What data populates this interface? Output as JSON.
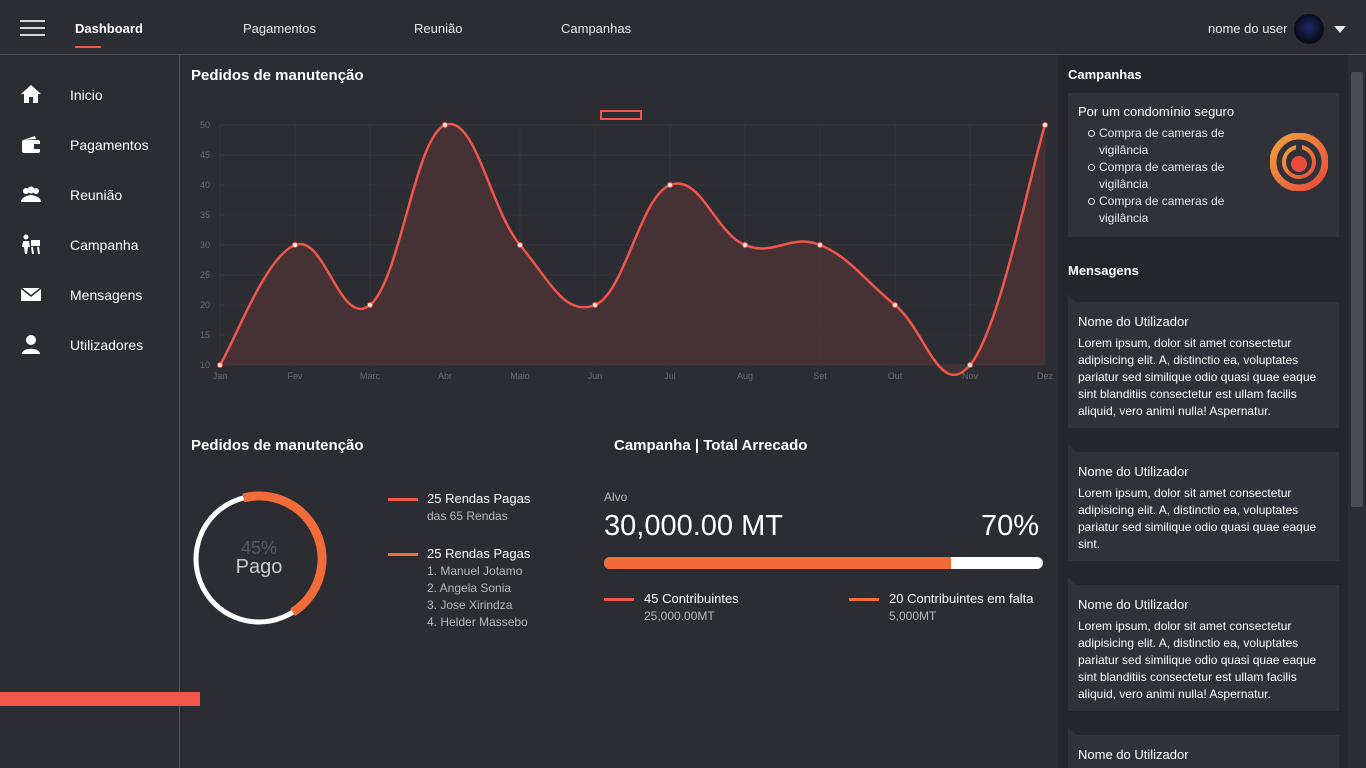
{
  "topbar": {
    "nav": [
      "Dashboard",
      "Pagamentos",
      "Reunião",
      "Campanhas"
    ],
    "user_name": "nome do user",
    "icons": {
      "menu": "hamburger-icon",
      "caret": "caret-down-icon"
    }
  },
  "sidebar": {
    "items": [
      {
        "label": "Inicio",
        "icon": "home-icon"
      },
      {
        "label": "Pagamentos",
        "icon": "wallet-icon"
      },
      {
        "label": "Reunião",
        "icon": "group-icon"
      },
      {
        "label": "Campanha",
        "icon": "campaign-icon"
      },
      {
        "label": "Mensagens",
        "icon": "envelope-icon"
      },
      {
        "label": "Utilizadores",
        "icon": "user-icon"
      }
    ]
  },
  "main": {
    "chart_title": "Pedidos de manutenção",
    "donut_title": "Pedidos de manutenção",
    "donut": {
      "percent_label": "45%",
      "label": "Pago",
      "value": 45
    },
    "legend": [
      {
        "title": "25 Rendas Pagas",
        "sub": [
          "das 65 Rendas"
        ]
      },
      {
        "title": "25 Rendas Pagas",
        "sub": [
          "1. Manuel Jotamo",
          "2. Angela Sonia",
          "3. Jose Xirindza",
          "4. Helder Massebo"
        ]
      }
    ],
    "campaign_title": "Campanha | Total Arrecado",
    "target_label": "Alvo",
    "target_amount": "30,000.00 MT",
    "target_percent_label": "70%",
    "target_percent_value": 79,
    "contrib": [
      {
        "title": "45 Contribuintes",
        "sub": "25,000.00MT"
      },
      {
        "title": "20 Contribuintes em falta",
        "sub": "5,000MT"
      }
    ]
  },
  "chart_data": {
    "type": "area",
    "categories": [
      "Jan",
      "Fev",
      "Marc",
      "Abr",
      "Maio",
      "Jun",
      "Jul",
      "Aug",
      "Set",
      "Out",
      "Nov",
      "Dez"
    ],
    "series": [
      {
        "values": [
          10,
          30,
          20,
          50,
          30,
          20,
          40,
          30,
          30,
          20,
          10,
          50
        ]
      }
    ],
    "ylim": [
      10,
      50
    ],
    "yticks": [
      10,
      15,
      20,
      25,
      30,
      35,
      40,
      45,
      50
    ],
    "grid": true,
    "legend": "top-center",
    "color": "#f0564a",
    "fill_color": "#4b3236"
  },
  "right": {
    "campanhas_title": "Campanhas",
    "campaign": {
      "title": "Por um condomínio seguro",
      "items": [
        "Compra de cameras de vigilância",
        "Compra de cameras de vigilância",
        "Compra de cameras de vigilância"
      ],
      "logo": "campaign-logo-icon"
    },
    "mensagens_title": "Mensagens",
    "messages": [
      {
        "name": "Nome do Utilizador",
        "text": "Lorem ipsum, dolor sit amet consectetur adipisicing elit. A, distinctio ea, voluptates pariatur sed similique odio quasi quae eaque sint blanditiis consectetur est ullam facilis aliquid, vero animi nulla! Aspernatur."
      },
      {
        "name": "Nome do Utilizador",
        "text": "Lorem ipsum, dolor sit amet consectetur adipisicing elit. A, distinctio ea, voluptates pariatur sed similique odio quasi quae eaque sint."
      },
      {
        "name": "Nome do Utilizador",
        "text": "Lorem ipsum, dolor sit amet consectetur adipisicing elit. A, distinctio ea, voluptates pariatur sed similique odio quasi quae eaque sint blanditiis consectetur est ullam facilis aliquid, vero animi nulla! Aspernatur."
      },
      {
        "name": "Nome do Utilizador",
        "text": ""
      }
    ]
  },
  "colors": {
    "background": "#2b2d33",
    "accent": "#f0564a",
    "orange": "#f26b38",
    "card": "#30323a"
  }
}
